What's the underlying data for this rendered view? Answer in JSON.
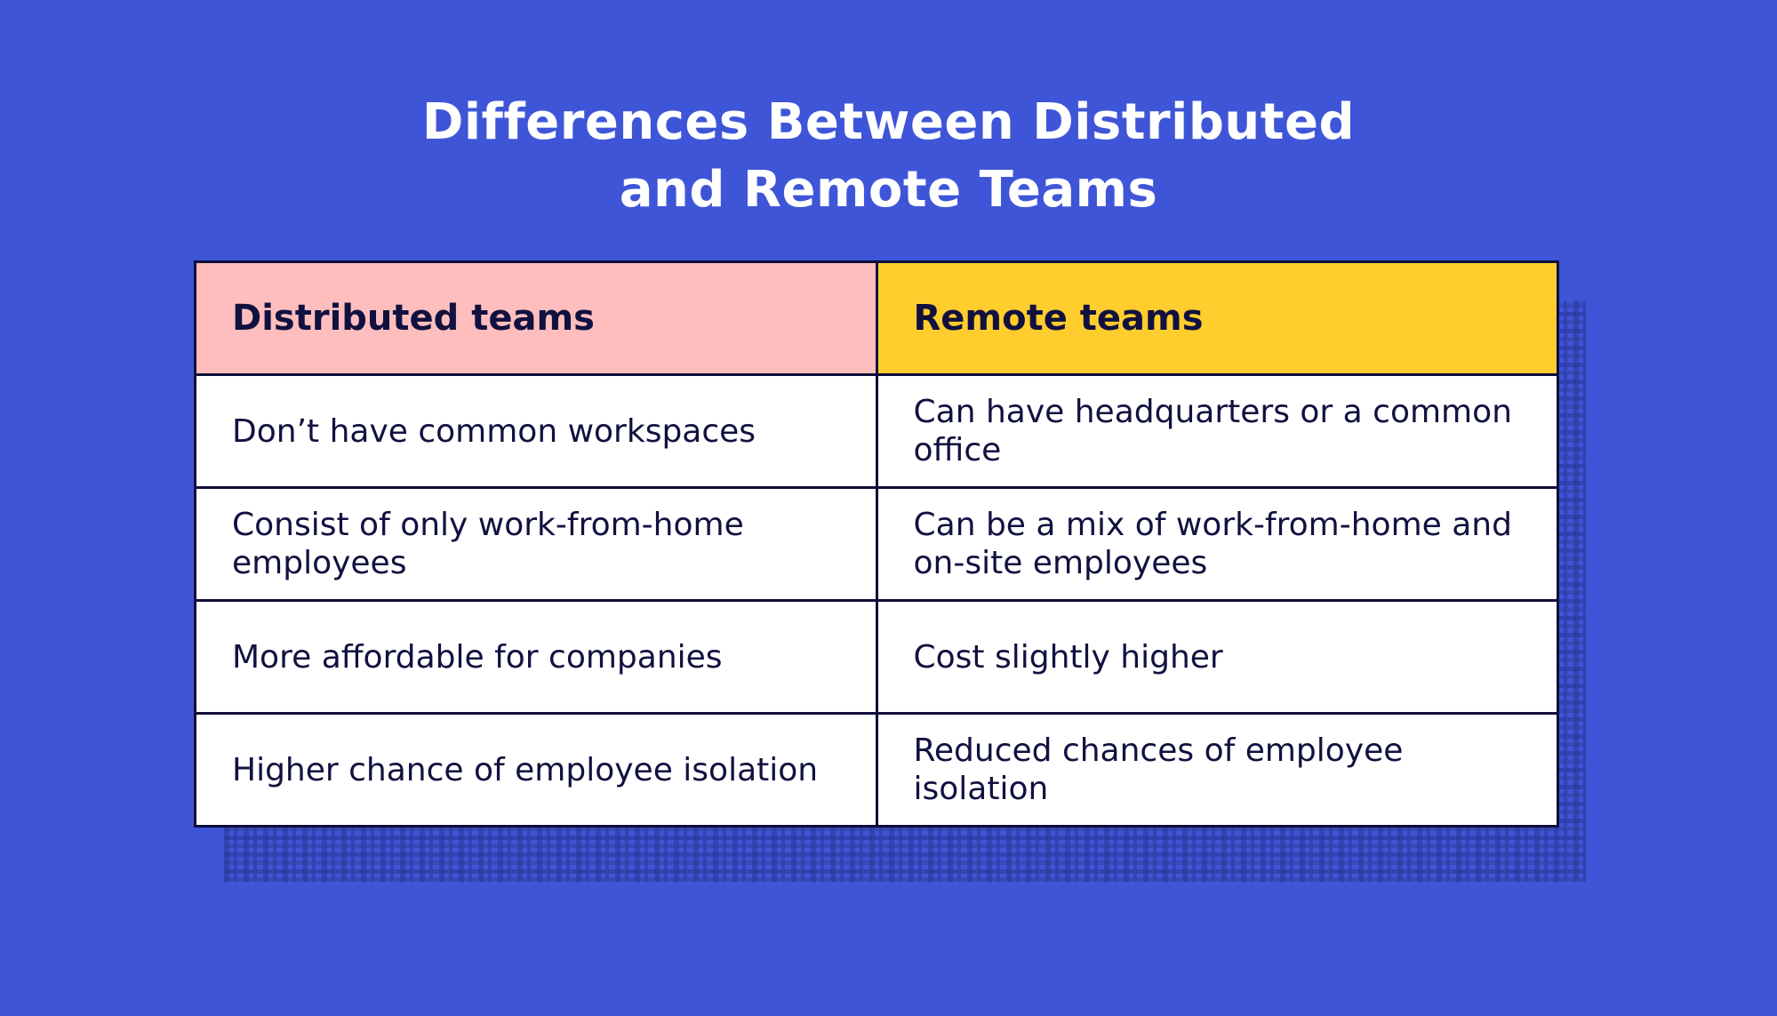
{
  "title": {
    "line1": "Differences Between Distributed",
    "line2": "and Remote Teams"
  },
  "colors": {
    "background": "#3f55d8",
    "header_distributed": "#ffbebe",
    "header_remote": "#ffcd2e",
    "border": "#0e0e3a",
    "text": "#111140"
  },
  "table": {
    "headers": [
      "Distributed teams",
      "Remote teams"
    ],
    "rows": [
      [
        "Don’t have common workspaces",
        "Can have headquarters or a common office"
      ],
      [
        "Consist of only work-from-home employees",
        "Can be a mix of work-from-home and on-site employees"
      ],
      [
        "More affordable for companies",
        "Cost slightly higher"
      ],
      [
        "Higher chance of employee isolation",
        "Reduced chances of employee isolation"
      ]
    ]
  }
}
